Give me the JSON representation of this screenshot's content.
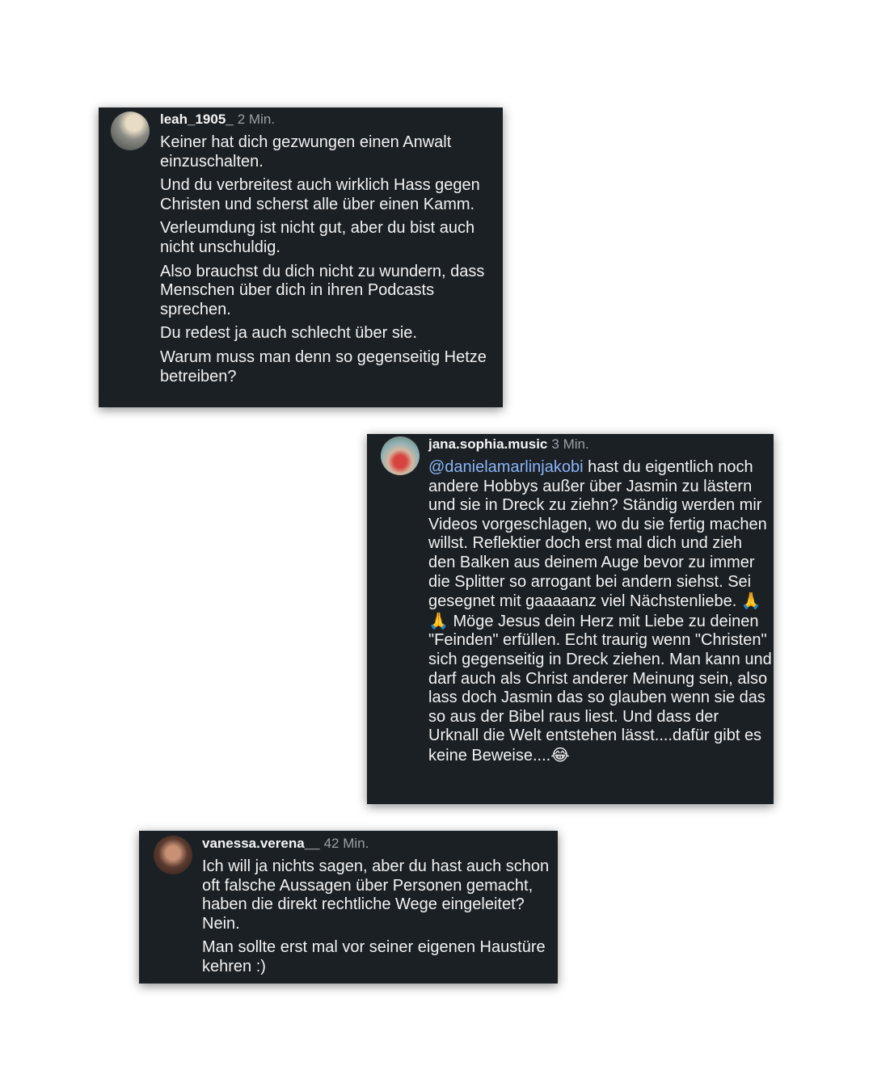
{
  "comments": [
    {
      "username": "leah_1905_",
      "time": "2 Min.",
      "paragraphs": [
        "Keiner hat dich gezwungen einen Anwalt einzuschalten.",
        "Und du verbreitest auch wirklich Hass gegen Christen und scherst alle über einen Kamm.",
        "Verleumdung ist nicht gut, aber du bist auch nicht unschuldig.",
        "Also brauchst du dich nicht zu wundern, dass Menschen über dich in ihren Podcasts sprechen.",
        "Du redest ja auch schlecht über sie.",
        "Warum muss man denn so gegenseitig Hetze betreiben?"
      ]
    },
    {
      "username": "jana.sophia.music",
      "time": "3 Min.",
      "mention": "@danielamarlinjakobi",
      "text_part1": " hast du eigentlich noch andere Hobbys außer über Jasmin zu lästern und sie in Dreck zu ziehn? Ständig werden mir Videos vorgeschlagen, wo du sie fertig machen willst. Reflektier doch erst mal dich und zieh den Balken aus deinem Auge bevor zu immer die Splitter so arrogant bei andern siehst. Sei gesegnet mit gaaaaanz viel Nächstenliebe. ",
      "emoji_pray": "🙏🙏",
      "text_part2": " Möge Jesus dein Herz mit Liebe zu deinen \"Feinden\" erfüllen. Echt traurig wenn \"Christen\" sich gegenseitig in Dreck ziehen. Man kann und darf auch als Christ anderer Meinung sein, also lass doch Jasmin das so glauben wenn sie das so aus der Bibel raus liest. Und dass der Urknall die Welt entstehen lässt....dafür gibt es keine Beweise....",
      "emoji_laugh": "😂"
    },
    {
      "username": "vanessa.verena__",
      "time": "42 Min.",
      "paragraphs": [
        "Ich will ja nichts sagen, aber du hast auch schon oft falsche Aussagen über Personen gemacht, haben die direkt rechtliche Wege eingeleitet? Nein.",
        "Man sollte erst mal vor seiner eigenen Haustüre kehren :)"
      ]
    }
  ]
}
